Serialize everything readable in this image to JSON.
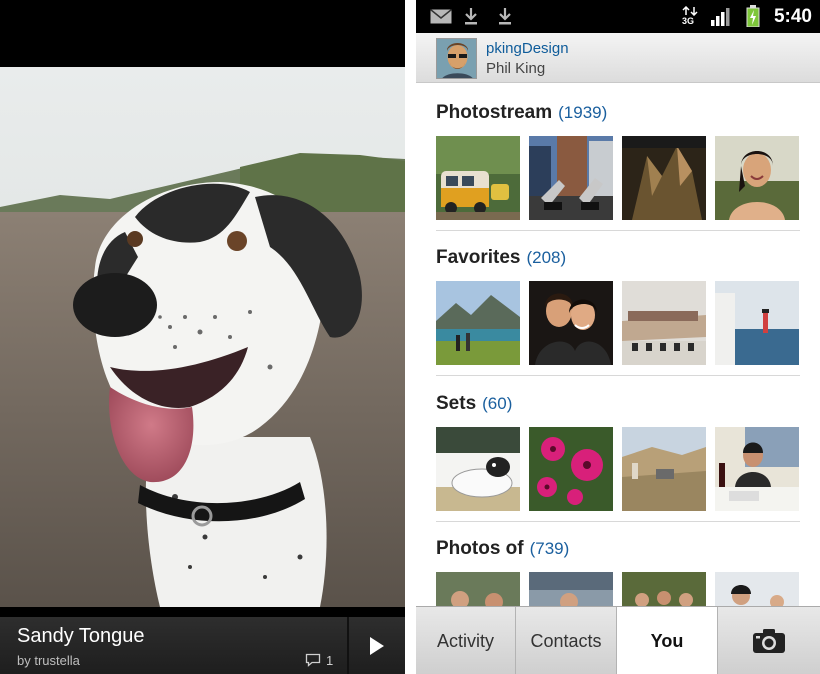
{
  "viewer": {
    "title": "Sandy Tongue",
    "author": "by trustella",
    "comment_count": "1",
    "play_icon": "play-icon",
    "comment_icon": "comment-icon"
  },
  "status_bar": {
    "time": "5:40",
    "network": "3G",
    "icons": [
      "mail-icon",
      "download-icon",
      "download-icon",
      "data-arrows-icon",
      "signal-icon",
      "battery-charging-icon"
    ]
  },
  "profile": {
    "username": "pkingDesign",
    "real_name": "Phil King"
  },
  "sections": [
    {
      "title": "Photostream",
      "count": "(1939)"
    },
    {
      "title": "Favorites",
      "count": "(208)"
    },
    {
      "title": "Sets",
      "count": "(60)"
    },
    {
      "title": "Photos of",
      "count": "(739)"
    }
  ],
  "tabs": [
    {
      "label": "Activity"
    },
    {
      "label": "Contacts"
    },
    {
      "label": "You"
    },
    {
      "label": "",
      "icon": "camera-icon"
    }
  ],
  "colors": {
    "link_blue": "#1a5f9e",
    "status_bar": "#000000",
    "active_tab": "#ffffff"
  }
}
